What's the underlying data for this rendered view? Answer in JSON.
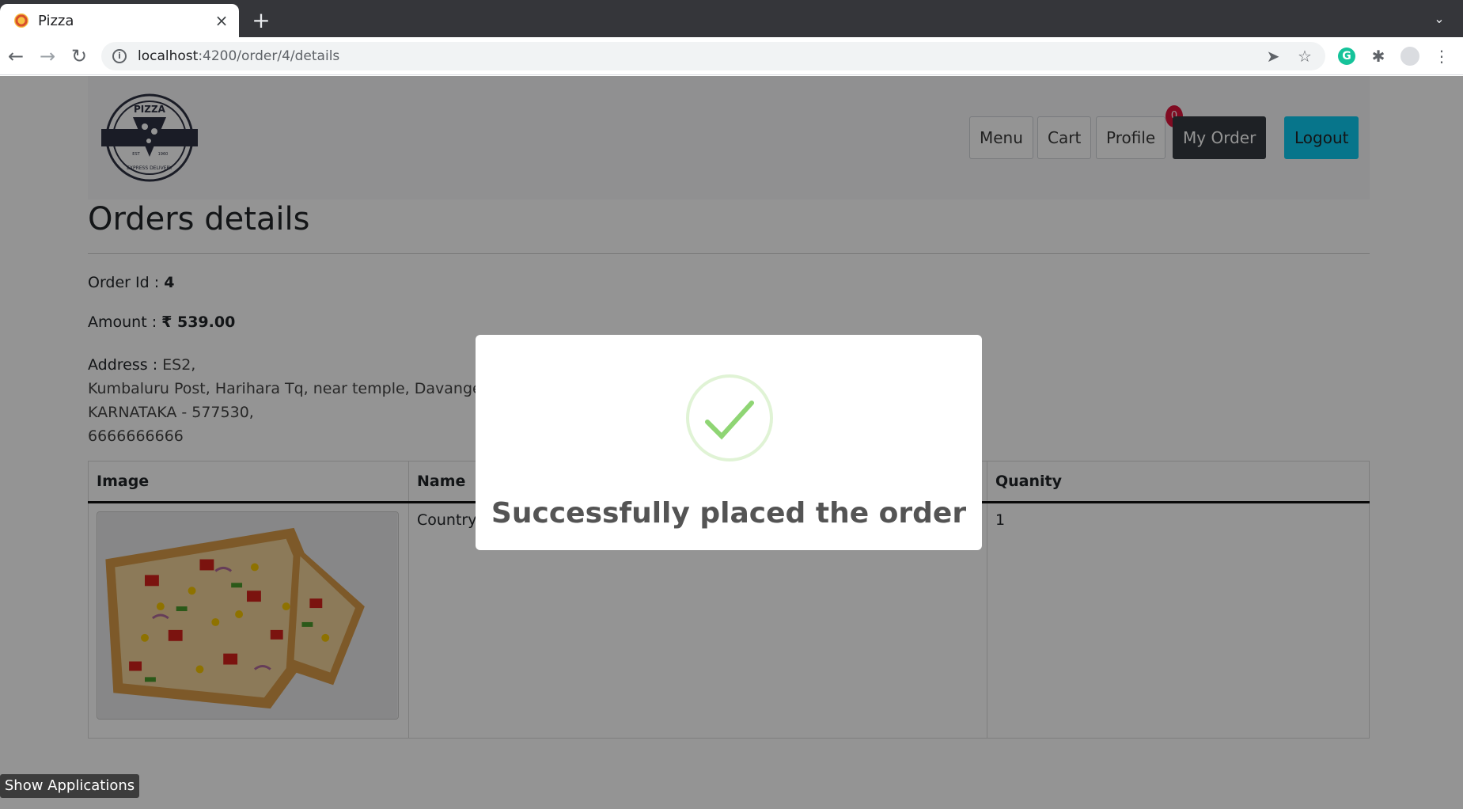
{
  "browser": {
    "tab_title": "Pizza",
    "tab_close": "×",
    "new_tab": "+",
    "url_host": "localhost",
    "url_path": ":4200/order/4/details",
    "tab_search_icon": "chevron-down-icon"
  },
  "navbar": {
    "menu_label": "Menu",
    "cart_label": "Cart",
    "cart_count": "0",
    "profile_label": "Profile",
    "my_order_label": "My Order",
    "logout_label": "Logout",
    "logo_text_top": "PIZZA",
    "logo_text_bottom": "EXPRESS DELIVERY",
    "logo_est": "EST",
    "logo_year": "1960"
  },
  "page": {
    "title": "Orders details",
    "order_id_label": "Order Id :",
    "order_id_value": "4",
    "amount_label": "Amount :",
    "amount_value": "₹ 539.00",
    "address_label": "Address :",
    "address_line1": "ES2,",
    "address_line2": "Kumbaluru Post, Harihara Tq, near temple, Davangere,",
    "address_line3": "KARNATAKA - 577530,",
    "address_line4": "6666666666"
  },
  "table": {
    "headers": [
      "Image",
      "Name",
      "Quanity"
    ],
    "rows": [
      {
        "name": "Country",
        "quantity": "1"
      }
    ]
  },
  "modal": {
    "title": "Successfully placed the order"
  },
  "taskbar": {
    "show_apps": "Show Applications"
  },
  "colors": {
    "success_check": "#8fd574",
    "logout_bg": "#0dcaf0",
    "my_order_bg": "#343a40",
    "badge_bg": "#dc143c"
  }
}
